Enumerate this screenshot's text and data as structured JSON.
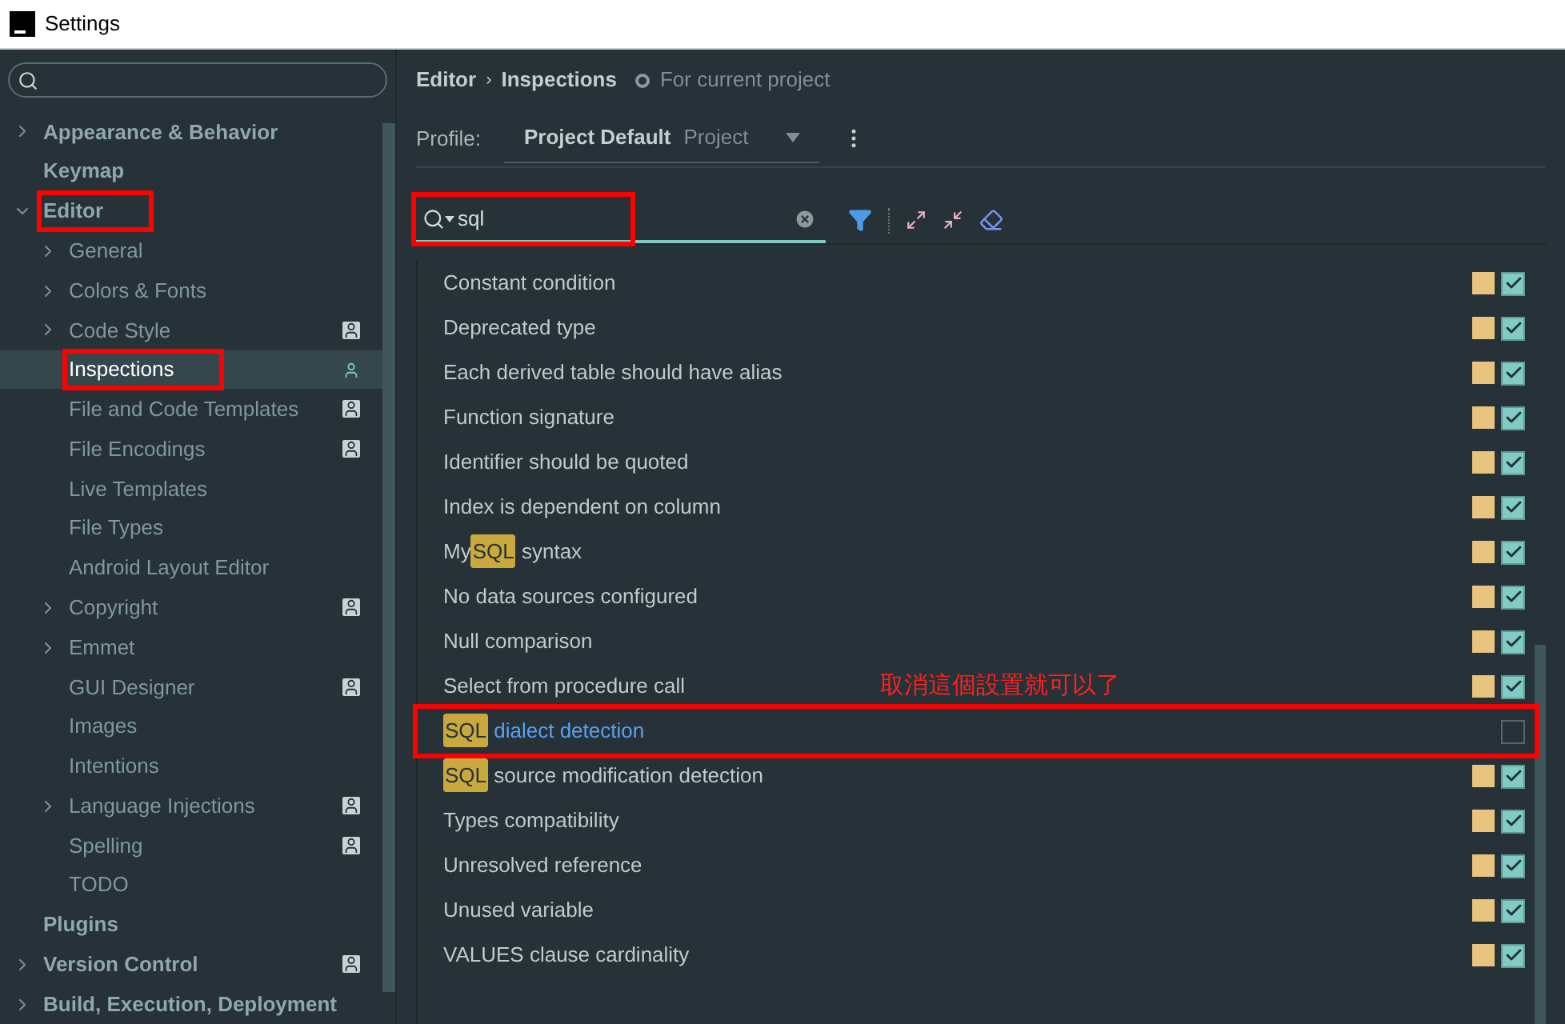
{
  "window": {
    "title": "Settings"
  },
  "sidebar": {
    "items": [
      {
        "label": "Appearance & Behavior",
        "expandable": true,
        "expanded": false,
        "selected": false,
        "annotated": false,
        "project_icon": false
      },
      {
        "label": "Keymap",
        "expandable": false,
        "expanded": false,
        "selected": false,
        "annotated": false,
        "project_icon": false
      },
      {
        "label": "Editor",
        "expandable": true,
        "expanded": true,
        "selected": false,
        "annotated": true,
        "project_icon": false,
        "children": [
          {
            "label": "General",
            "expandable": true,
            "expanded": false,
            "selected": false,
            "annotated": false,
            "project_icon": false
          },
          {
            "label": "Colors & Fonts",
            "expandable": true,
            "expanded": false,
            "selected": false,
            "annotated": false,
            "project_icon": false
          },
          {
            "label": "Code Style",
            "expandable": true,
            "expanded": false,
            "selected": false,
            "annotated": false,
            "project_icon": true
          },
          {
            "label": "Inspections",
            "expandable": false,
            "expanded": false,
            "selected": true,
            "annotated": true,
            "project_icon": true
          },
          {
            "label": "File and Code Templates",
            "expandable": false,
            "expanded": false,
            "selected": false,
            "annotated": false,
            "project_icon": true
          },
          {
            "label": "File Encodings",
            "expandable": false,
            "expanded": false,
            "selected": false,
            "annotated": false,
            "project_icon": true
          },
          {
            "label": "Live Templates",
            "expandable": false,
            "expanded": false,
            "selected": false,
            "annotated": false,
            "project_icon": false
          },
          {
            "label": "File Types",
            "expandable": false,
            "expanded": false,
            "selected": false,
            "annotated": false,
            "project_icon": false
          },
          {
            "label": "Android Layout Editor",
            "expandable": false,
            "expanded": false,
            "selected": false,
            "annotated": false,
            "project_icon": false
          },
          {
            "label": "Copyright",
            "expandable": true,
            "expanded": false,
            "selected": false,
            "annotated": false,
            "project_icon": true
          },
          {
            "label": "Emmet",
            "expandable": true,
            "expanded": false,
            "selected": false,
            "annotated": false,
            "project_icon": false
          },
          {
            "label": "GUI Designer",
            "expandable": false,
            "expanded": false,
            "selected": false,
            "annotated": false,
            "project_icon": true
          },
          {
            "label": "Images",
            "expandable": false,
            "expanded": false,
            "selected": false,
            "annotated": false,
            "project_icon": false
          },
          {
            "label": "Intentions",
            "expandable": false,
            "expanded": false,
            "selected": false,
            "annotated": false,
            "project_icon": false
          },
          {
            "label": "Language Injections",
            "expandable": true,
            "expanded": false,
            "selected": false,
            "annotated": false,
            "project_icon": true
          },
          {
            "label": "Spelling",
            "expandable": false,
            "expanded": false,
            "selected": false,
            "annotated": false,
            "project_icon": true
          },
          {
            "label": "TODO",
            "expandable": false,
            "expanded": false,
            "selected": false,
            "annotated": false,
            "project_icon": false
          }
        ]
      },
      {
        "label": "Plugins",
        "expandable": false,
        "expanded": false,
        "selected": false,
        "annotated": false,
        "project_icon": false
      },
      {
        "label": "Version Control",
        "expandable": true,
        "expanded": false,
        "selected": false,
        "annotated": false,
        "project_icon": true
      },
      {
        "label": "Build, Execution, Deployment",
        "expandable": true,
        "expanded": false,
        "selected": false,
        "annotated": false,
        "project_icon": false
      }
    ]
  },
  "breadcrumb": {
    "parent": "Editor",
    "separator": "›",
    "current": "Inspections",
    "scope": "For current project"
  },
  "profile": {
    "label": "Profile:",
    "name": "Project Default",
    "scope": "Project"
  },
  "filter": {
    "value": "sql",
    "annotated": true
  },
  "inspections": [
    {
      "parts": [
        {
          "text": "Constant condition",
          "match": false
        }
      ],
      "selected": false,
      "annotated": false,
      "checked": true
    },
    {
      "parts": [
        {
          "text": "Deprecated type",
          "match": false
        }
      ],
      "selected": false,
      "annotated": false,
      "checked": true
    },
    {
      "parts": [
        {
          "text": "Each derived table should have alias",
          "match": false
        }
      ],
      "selected": false,
      "annotated": false,
      "checked": true
    },
    {
      "parts": [
        {
          "text": "Function signature",
          "match": false
        }
      ],
      "selected": false,
      "annotated": false,
      "checked": true
    },
    {
      "parts": [
        {
          "text": "Identifier should be quoted",
          "match": false
        }
      ],
      "selected": false,
      "annotated": false,
      "checked": true
    },
    {
      "parts": [
        {
          "text": "Index is dependent on column",
          "match": false
        }
      ],
      "selected": false,
      "annotated": false,
      "checked": true
    },
    {
      "parts": [
        {
          "text": "My",
          "match": false
        },
        {
          "text": "SQL",
          "match": true
        },
        {
          "text": " syntax",
          "match": false
        }
      ],
      "selected": false,
      "annotated": false,
      "checked": true
    },
    {
      "parts": [
        {
          "text": "No data sources configured",
          "match": false
        }
      ],
      "selected": false,
      "annotated": false,
      "checked": true
    },
    {
      "parts": [
        {
          "text": "Null comparison",
          "match": false
        }
      ],
      "selected": false,
      "annotated": false,
      "checked": true
    },
    {
      "parts": [
        {
          "text": "Select from procedure call",
          "match": false
        }
      ],
      "selected": false,
      "annotated": false,
      "checked": true,
      "note": "取消這個設置就可以了"
    },
    {
      "parts": [
        {
          "text": "SQL",
          "match": true
        },
        {
          "text": " dialect detection",
          "match": false
        }
      ],
      "selected": true,
      "annotated": true,
      "checked": false
    },
    {
      "parts": [
        {
          "text": "SQL",
          "match": true
        },
        {
          "text": " source modification detection",
          "match": false
        }
      ],
      "selected": false,
      "annotated": false,
      "checked": true
    },
    {
      "parts": [
        {
          "text": "Types compatibility",
          "match": false
        }
      ],
      "selected": false,
      "annotated": false,
      "checked": true
    },
    {
      "parts": [
        {
          "text": "Unresolved reference",
          "match": false
        }
      ],
      "selected": false,
      "annotated": false,
      "checked": true
    },
    {
      "parts": [
        {
          "text": "Unused variable",
          "match": false
        }
      ],
      "selected": false,
      "annotated": false,
      "checked": true
    },
    {
      "parts": [
        {
          "text": "VALUES clause cardinality",
          "match": false
        }
      ],
      "selected": false,
      "annotated": false,
      "checked": true
    }
  ]
}
